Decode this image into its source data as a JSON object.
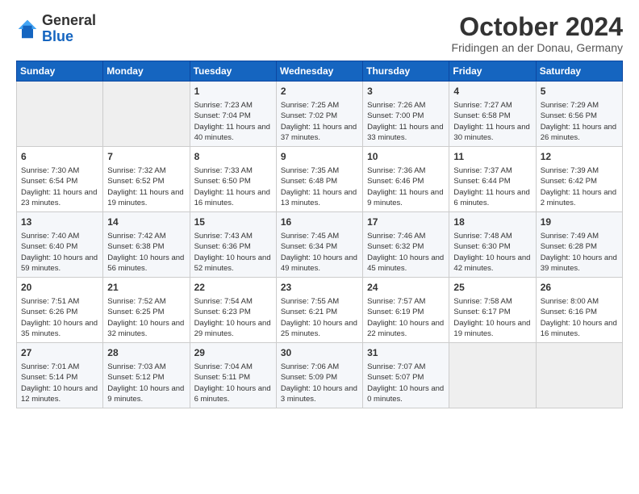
{
  "header": {
    "logo": {
      "general": "General",
      "blue": "Blue"
    },
    "month": "October 2024",
    "location": "Fridingen an der Donau, Germany"
  },
  "days_of_week": [
    "Sunday",
    "Monday",
    "Tuesday",
    "Wednesday",
    "Thursday",
    "Friday",
    "Saturday"
  ],
  "weeks": [
    [
      {
        "day": "",
        "content": ""
      },
      {
        "day": "",
        "content": ""
      },
      {
        "day": "1",
        "content": "Sunrise: 7:23 AM\nSunset: 7:04 PM\nDaylight: 11 hours and 40 minutes."
      },
      {
        "day": "2",
        "content": "Sunrise: 7:25 AM\nSunset: 7:02 PM\nDaylight: 11 hours and 37 minutes."
      },
      {
        "day": "3",
        "content": "Sunrise: 7:26 AM\nSunset: 7:00 PM\nDaylight: 11 hours and 33 minutes."
      },
      {
        "day": "4",
        "content": "Sunrise: 7:27 AM\nSunset: 6:58 PM\nDaylight: 11 hours and 30 minutes."
      },
      {
        "day": "5",
        "content": "Sunrise: 7:29 AM\nSunset: 6:56 PM\nDaylight: 11 hours and 26 minutes."
      }
    ],
    [
      {
        "day": "6",
        "content": "Sunrise: 7:30 AM\nSunset: 6:54 PM\nDaylight: 11 hours and 23 minutes."
      },
      {
        "day": "7",
        "content": "Sunrise: 7:32 AM\nSunset: 6:52 PM\nDaylight: 11 hours and 19 minutes."
      },
      {
        "day": "8",
        "content": "Sunrise: 7:33 AM\nSunset: 6:50 PM\nDaylight: 11 hours and 16 minutes."
      },
      {
        "day": "9",
        "content": "Sunrise: 7:35 AM\nSunset: 6:48 PM\nDaylight: 11 hours and 13 minutes."
      },
      {
        "day": "10",
        "content": "Sunrise: 7:36 AM\nSunset: 6:46 PM\nDaylight: 11 hours and 9 minutes."
      },
      {
        "day": "11",
        "content": "Sunrise: 7:37 AM\nSunset: 6:44 PM\nDaylight: 11 hours and 6 minutes."
      },
      {
        "day": "12",
        "content": "Sunrise: 7:39 AM\nSunset: 6:42 PM\nDaylight: 11 hours and 2 minutes."
      }
    ],
    [
      {
        "day": "13",
        "content": "Sunrise: 7:40 AM\nSunset: 6:40 PM\nDaylight: 10 hours and 59 minutes."
      },
      {
        "day": "14",
        "content": "Sunrise: 7:42 AM\nSunset: 6:38 PM\nDaylight: 10 hours and 56 minutes."
      },
      {
        "day": "15",
        "content": "Sunrise: 7:43 AM\nSunset: 6:36 PM\nDaylight: 10 hours and 52 minutes."
      },
      {
        "day": "16",
        "content": "Sunrise: 7:45 AM\nSunset: 6:34 PM\nDaylight: 10 hours and 49 minutes."
      },
      {
        "day": "17",
        "content": "Sunrise: 7:46 AM\nSunset: 6:32 PM\nDaylight: 10 hours and 45 minutes."
      },
      {
        "day": "18",
        "content": "Sunrise: 7:48 AM\nSunset: 6:30 PM\nDaylight: 10 hours and 42 minutes."
      },
      {
        "day": "19",
        "content": "Sunrise: 7:49 AM\nSunset: 6:28 PM\nDaylight: 10 hours and 39 minutes."
      }
    ],
    [
      {
        "day": "20",
        "content": "Sunrise: 7:51 AM\nSunset: 6:26 PM\nDaylight: 10 hours and 35 minutes."
      },
      {
        "day": "21",
        "content": "Sunrise: 7:52 AM\nSunset: 6:25 PM\nDaylight: 10 hours and 32 minutes."
      },
      {
        "day": "22",
        "content": "Sunrise: 7:54 AM\nSunset: 6:23 PM\nDaylight: 10 hours and 29 minutes."
      },
      {
        "day": "23",
        "content": "Sunrise: 7:55 AM\nSunset: 6:21 PM\nDaylight: 10 hours and 25 minutes."
      },
      {
        "day": "24",
        "content": "Sunrise: 7:57 AM\nSunset: 6:19 PM\nDaylight: 10 hours and 22 minutes."
      },
      {
        "day": "25",
        "content": "Sunrise: 7:58 AM\nSunset: 6:17 PM\nDaylight: 10 hours and 19 minutes."
      },
      {
        "day": "26",
        "content": "Sunrise: 8:00 AM\nSunset: 6:16 PM\nDaylight: 10 hours and 16 minutes."
      }
    ],
    [
      {
        "day": "27",
        "content": "Sunrise: 7:01 AM\nSunset: 5:14 PM\nDaylight: 10 hours and 12 minutes."
      },
      {
        "day": "28",
        "content": "Sunrise: 7:03 AM\nSunset: 5:12 PM\nDaylight: 10 hours and 9 minutes."
      },
      {
        "day": "29",
        "content": "Sunrise: 7:04 AM\nSunset: 5:11 PM\nDaylight: 10 hours and 6 minutes."
      },
      {
        "day": "30",
        "content": "Sunrise: 7:06 AM\nSunset: 5:09 PM\nDaylight: 10 hours and 3 minutes."
      },
      {
        "day": "31",
        "content": "Sunrise: 7:07 AM\nSunset: 5:07 PM\nDaylight: 10 hours and 0 minutes."
      },
      {
        "day": "",
        "content": ""
      },
      {
        "day": "",
        "content": ""
      }
    ]
  ]
}
